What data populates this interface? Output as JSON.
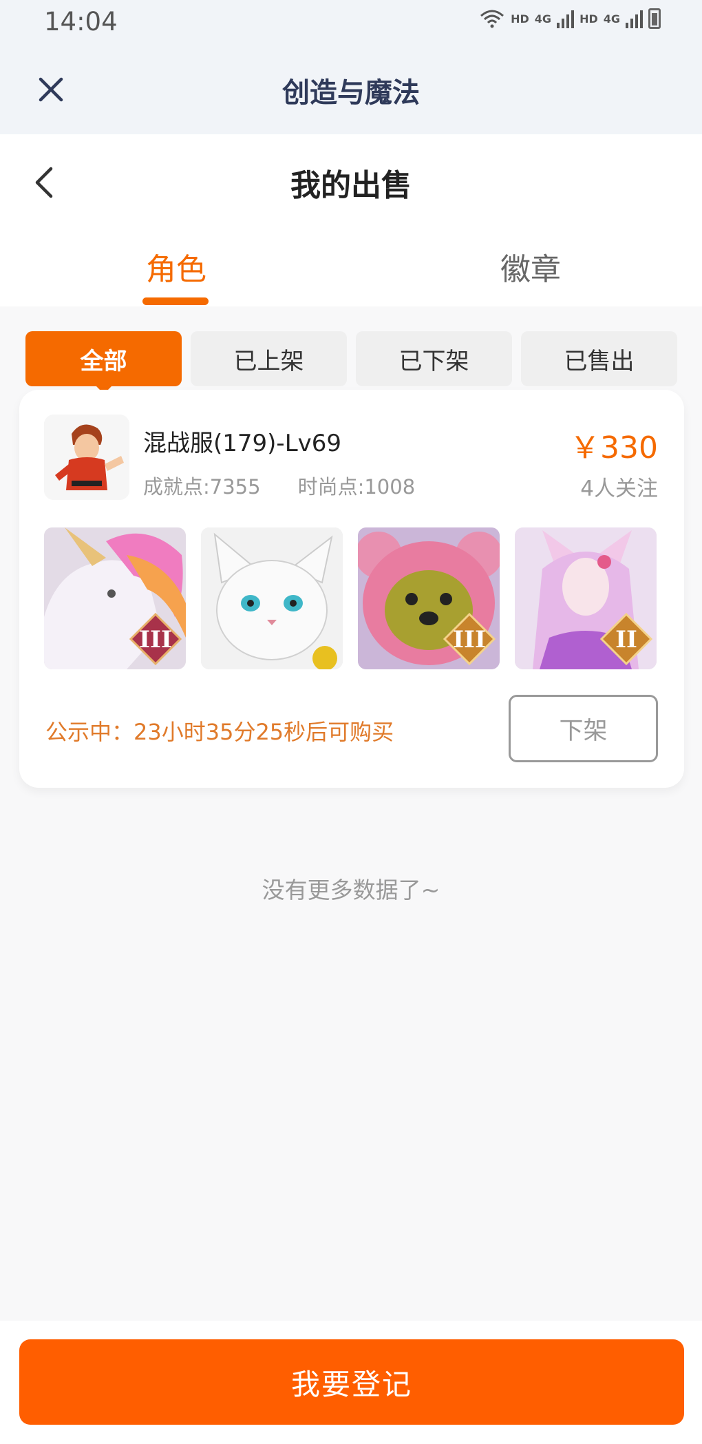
{
  "status_bar": {
    "time": "14:04",
    "signal_1": "HD",
    "net_1": "4G",
    "signal_2": "HD",
    "net_2": "4G"
  },
  "app_bar": {
    "title": "创造与魔法",
    "close_icon": "close-icon"
  },
  "header": {
    "title": "我的出售",
    "back_icon": "back-arrow-icon"
  },
  "tabs": [
    {
      "label": "角色",
      "active": true
    },
    {
      "label": "徽章",
      "active": false
    }
  ],
  "filters": [
    {
      "label": "全部",
      "active": true
    },
    {
      "label": "已上架",
      "active": false
    },
    {
      "label": "已下架",
      "active": false
    },
    {
      "label": "已售出",
      "active": false
    }
  ],
  "listing": {
    "name": "混战服(179)-Lv69",
    "achievement": "成就点:7355",
    "fashion": "时尚点:1008",
    "price": "￥330",
    "followers": "4人关注",
    "pets": [
      {
        "name": "unicorn",
        "tier": "III"
      },
      {
        "name": "white-fox",
        "tier": ""
      },
      {
        "name": "pink-bear",
        "tier": "III"
      },
      {
        "name": "fox-maiden",
        "tier": "II"
      }
    ],
    "notice": "公示中：23小时35分25秒后可购买",
    "delist_label": "下架"
  },
  "empty_text": "没有更多数据了~",
  "register_label": "我要登记",
  "colors": {
    "accent": "#f56a00",
    "button": "#ff5e00",
    "notice": "#e07a2a"
  }
}
